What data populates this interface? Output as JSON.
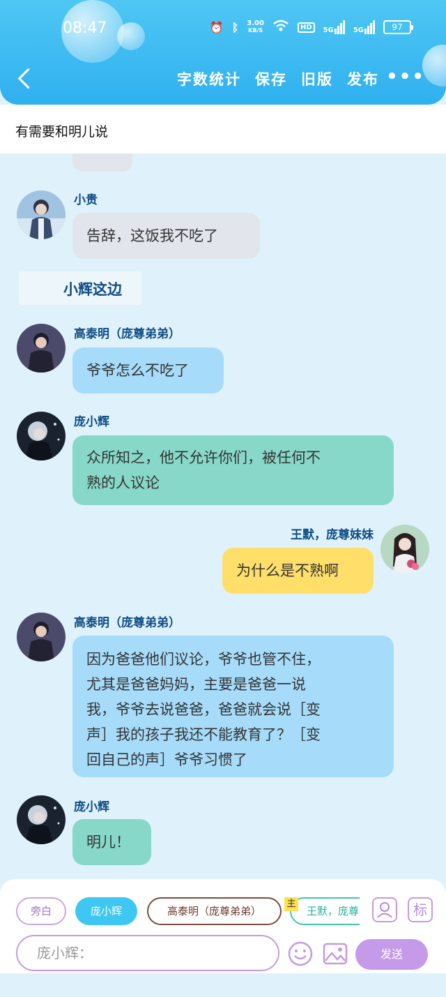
{
  "status_bar": {
    "time": "08:47",
    "net_speed_value": "3.00",
    "net_speed_unit": "KB/S",
    "hd_label": "HD",
    "signal1": "5G",
    "signal2": "5G",
    "battery": "97"
  },
  "toolbar": {
    "word_count": "字数统计",
    "save": "保存",
    "old_version": "旧版",
    "publish": "发布",
    "more": "•••"
  },
  "notice": "有需要和明儿说",
  "scene_tag": "小辉这边",
  "messages": [
    {
      "speaker": "小贵",
      "text": "告辞，这饭我不吃了"
    },
    {
      "speaker": "高泰明（庞尊弟弟）",
      "text": "爷爷怎么不吃了"
    },
    {
      "speaker": "庞小辉",
      "text": "众所知之，他不允许你们，被任何不熟的人议论"
    },
    {
      "speaker": "王默，庞尊妹妹",
      "text": "为什么是不熟啊"
    },
    {
      "speaker": "高泰明（庞尊弟弟）",
      "text": "因为爸爸他们议论，爷爷也管不住，尤其是爸爸妈妈，主要是爸爸一说我，爷爷去说爸爸，爸爸就会说［变声］我的孩子我还不能教育了？［变回自己的声］爷爷习惯了"
    },
    {
      "speaker": "庞小辉",
      "text": "明儿！"
    }
  ],
  "msg5_lines": [
    "因为爸爸他们议论，爷爷也管不住，",
    "尤其是爸爸妈妈，主要是爸爸一说",
    "我，爷爷去说爸爸，爸爸就会说［变",
    "声］我的孩子我还不能教育了？［变",
    "回自己的声］爷爷习惯了"
  ],
  "msg3_lines": [
    "众所知之，他不允许你们，被任何不",
    "熟的人议论"
  ],
  "roles": {
    "narrator": "旁白",
    "pang": "庞小辉",
    "gao": "高泰明（庞尊弟弟）",
    "wang": "王默，庞尊",
    "main_tag": "主",
    "mark_icon": "标"
  },
  "input": {
    "placeholder": "庞小辉："
  },
  "send": "发送",
  "colors": {
    "header": "#3bb9f2",
    "bg": "#dff2fc",
    "blue_bubble": "#a6dcfa",
    "green_bubble": "#87d8c9",
    "yellow_bubble": "#ffdf6a",
    "gray_bubble": "#e3e5ec",
    "name": "#0e4c83",
    "send": "#c59ae8"
  }
}
